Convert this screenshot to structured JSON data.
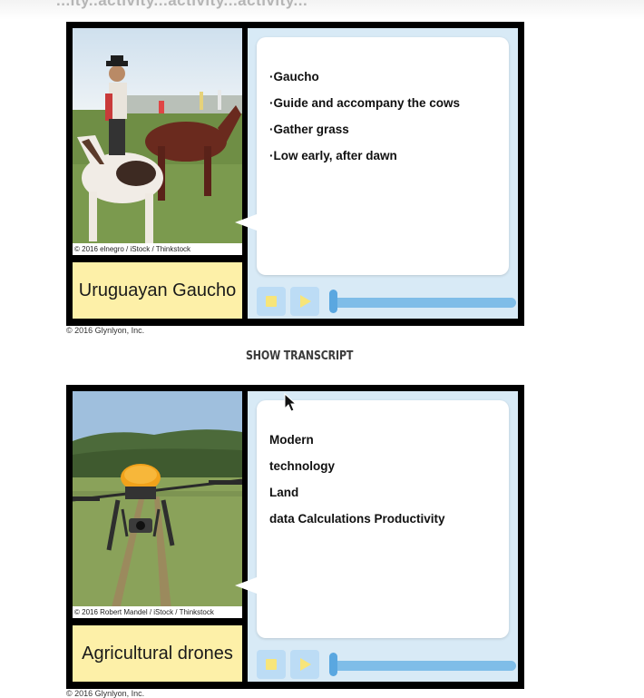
{
  "top_text": "...ity..activity...activity...activity...",
  "cards": [
    {
      "caption": "Uruguayan Gaucho",
      "photo_credit": "© 2016 elnegro / iStock / Thinkstock",
      "image_icon": "gaucho-horse-photo",
      "bullets": [
        "·Gaucho",
        "·Guide and accompany the cows",
        "·Gather grass",
        "·Low early, after dawn"
      ],
      "copyright": "© 2016 Glynlyon, Inc.",
      "progress": 0
    },
    {
      "caption": "Agricultural drones",
      "photo_credit": "© 2016 Robert Mandel / iStock / Thinkstock",
      "image_icon": "agricultural-drone-photo",
      "bullets": [
        "Modern",
        "technology",
        "Land",
        "data Calculations Productivity"
      ],
      "copyright": "© 2016 Glynlyon, Inc.",
      "progress": 0
    }
  ],
  "show_transcript": "SHOW TRANSCRIPT",
  "controls": {
    "stop_icon": "stop-icon",
    "play_icon": "play-icon"
  },
  "colors": {
    "panel": "#d8eaf6",
    "caption_bg": "#fdf0a8",
    "track": "#7fbde8",
    "button_glyph": "#f7e57a"
  }
}
